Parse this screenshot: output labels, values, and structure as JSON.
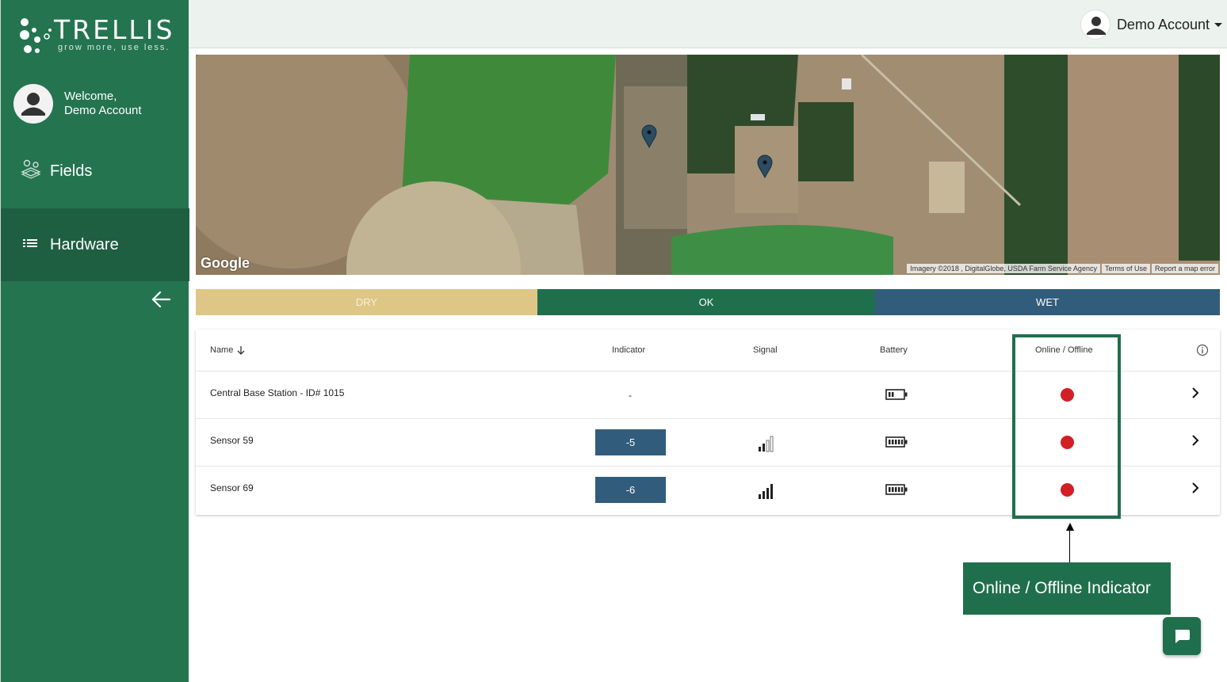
{
  "brand": {
    "name": "TRELLIS",
    "tagline": "grow more, use less."
  },
  "sidebar": {
    "welcome_line1": "Welcome,",
    "welcome_line2": "Demo Account",
    "items": [
      {
        "label": "Fields",
        "icon": "fields-map-icon"
      },
      {
        "label": "Hardware",
        "icon": "list-icon",
        "active": true
      }
    ],
    "collapse_icon": "arrow-left-icon"
  },
  "header": {
    "account_name": "Demo Account"
  },
  "map": {
    "google_logo": "Google",
    "attribution": "Imagery ©2018 , DigitalGlobe, USDA Farm Service Agency",
    "terms": "Terms of Use",
    "report": "Report a map error"
  },
  "legend": {
    "dry": "DRY",
    "ok": "OK",
    "wet": "WET"
  },
  "table": {
    "columns": {
      "name": "Name",
      "indicator": "Indicator",
      "signal": "Signal",
      "battery": "Battery",
      "status": "Online / Offline"
    },
    "rows": [
      {
        "name": "Central Base Station - ID# 1015",
        "indicator": "-",
        "signal_bars": 0,
        "battery_level": 0.25,
        "online": false
      },
      {
        "name": "Sensor 59",
        "indicator": "-5",
        "signal_bars": 2,
        "battery_level": 1.0,
        "online": false
      },
      {
        "name": "Sensor 69",
        "indicator": "-6",
        "signal_bars": 4,
        "battery_level": 1.0,
        "online": false
      }
    ]
  },
  "callout": {
    "text": "Online / Offline Indicator"
  },
  "colors": {
    "sidebar": "#24744f",
    "ok": "#1f6f4c",
    "dry": "#dec786",
    "wet": "#325c7b",
    "offline": "#d21f26"
  }
}
